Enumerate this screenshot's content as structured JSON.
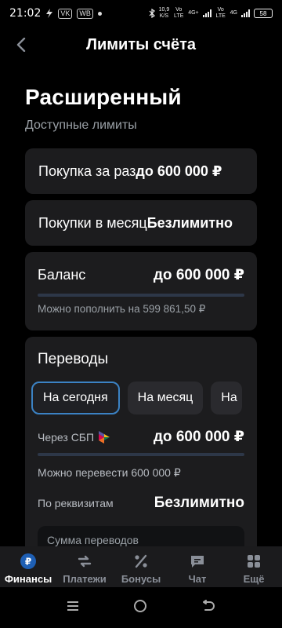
{
  "status_bar": {
    "time": "21:02",
    "mini_icons": [
      "VK",
      "WB"
    ],
    "net_speed": "10,9",
    "net_unit": "K/S",
    "sim1": "Vo LTE",
    "lte1": "4G+",
    "sim2": "Vo LTE",
    "lte2": "4G",
    "battery": "58"
  },
  "header": {
    "title": "Лимиты счёта",
    "back_icon": "chevron-left-icon"
  },
  "page": {
    "title": "Расширенный",
    "subtitle": "Доступные лимиты"
  },
  "limits": {
    "day_purchase": {
      "label": "Покупка за раз",
      "value": "до 600 000 ₽"
    },
    "month_purchase": {
      "label": "Покупки в месяц",
      "value": "Безлимитно"
    }
  },
  "balance": {
    "label": "Баланс",
    "value": "до 600 000 ₽",
    "progress": 0.0002,
    "note": "Можно пополнить на 599 861,50 ₽"
  },
  "transfers": {
    "title": "Переводы",
    "tabs": [
      {
        "label": "На сегодня",
        "active": true
      },
      {
        "label": "На месяц",
        "active": false
      },
      {
        "label": "На",
        "active": false
      }
    ],
    "sbp": {
      "label": "Через СБП",
      "value": "до 600 000 ₽",
      "progress": 0,
      "note": "Можно перевести 600 000 ₽"
    },
    "requisites": {
      "label": "По реквизитам",
      "value": "Безлимитно"
    },
    "sum_label": "Сумма переводов"
  },
  "bottom_nav": [
    {
      "label": "Финансы",
      "icon": "ruble-icon",
      "active": true
    },
    {
      "label": "Платежи",
      "icon": "transfer-icon",
      "active": false
    },
    {
      "label": "Бонусы",
      "icon": "percent-icon",
      "active": false
    },
    {
      "label": "Чат",
      "icon": "chat-icon",
      "active": false
    },
    {
      "label": "Ещё",
      "icon": "grid-icon",
      "active": false
    }
  ],
  "colors": {
    "background": "#000000",
    "card": "#1c1c1e",
    "accent": "#3b82c4",
    "nav_active": "#1e5fb4",
    "muted": "#9aa0a6"
  }
}
